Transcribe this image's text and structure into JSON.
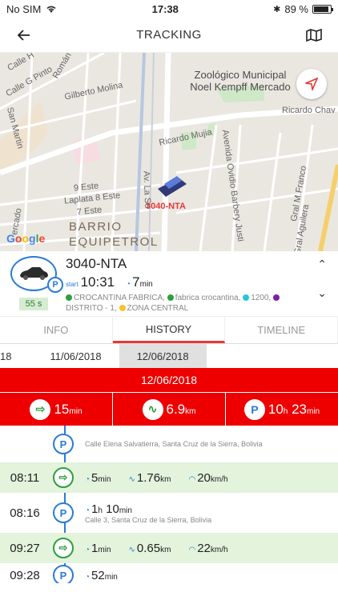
{
  "status": {
    "carrier": "No SIM",
    "time": "17:38",
    "battery": "89 %",
    "battery_level": 0.89
  },
  "nav": {
    "title": "TRACKING",
    "back_icon": "arrow-left-icon",
    "map_icon": "map-icon"
  },
  "map": {
    "labels": {
      "calle_h": "Calle H",
      "calle_g": "Calle G Pinto",
      "roman": "Román",
      "gilberto": "Gilberto Molina",
      "san_martin": "San Martin",
      "ricardo_chavez": "Ricardo Chav",
      "ricardo_mujia": "Ricardo Mujia",
      "este9": "9 Este",
      "laplata": "Laplata 8 Este",
      "este7": "7 Este",
      "av_la_se": "Av. La Se",
      "ovidio": "Avenida Ovidio Barbery Justi",
      "franco": "Gral M.Franco",
      "aguilera": "Gral Aguilera",
      "mercado": "ercado"
    },
    "poi": "Zoológico Municipal Noel Kempff Mercado",
    "district": "BARRIO EQUIPETROL",
    "car_label": "3040-NTA",
    "google": "Google"
  },
  "vehicle": {
    "plate": "3040-NTA",
    "start_label": "start",
    "start_time": "10:31",
    "duration": "7",
    "duration_unit": "min",
    "seconds": "55 s",
    "geofences": [
      {
        "name": "CROCANTINA FABRICA,",
        "color": "#2e9e3e"
      },
      {
        "name": "fabrica crocantina,",
        "color": "#2e9e3e"
      },
      {
        "name": "1200,",
        "color": "#26c6da"
      },
      {
        "name": "DISTRITO - 1,",
        "color": "#7b1fa2"
      },
      {
        "name": "ZONA CENTRAL",
        "color": "#fbc02d"
      }
    ]
  },
  "tabs": [
    "INFO",
    "HISTORY",
    "TIMELINE"
  ],
  "dates": [
    "18",
    "11/06/2018",
    "12/06/2018"
  ],
  "selected_date": "12/06/2018",
  "summary": {
    "moving": {
      "value": "15",
      "unit": "min"
    },
    "distance": {
      "value": "6.9",
      "unit": "km"
    },
    "parked": {
      "hours": "10",
      "h": "h",
      "minutes": "23",
      "unit": "min"
    }
  },
  "timeline": {
    "first_address": "Calle Elena Salvatierra, Santa Cruz de la Sierra, Bolivia",
    "rows": [
      {
        "time": "08:11",
        "type": "moving",
        "dur": "5",
        "dur_unit": "min",
        "dist": "1.76",
        "dist_unit": "km",
        "speed": "20",
        "speed_unit": "km/h"
      },
      {
        "time": "08:16",
        "type": "parked",
        "hours": "1",
        "h": "h",
        "mins": "10",
        "mins_unit": "min",
        "address": "Calle 3, Santa Cruz de la Sierra, Bolivia"
      },
      {
        "time": "09:27",
        "type": "moving",
        "dur": "1",
        "dur_unit": "min",
        "dist": "0.65",
        "dist_unit": "km",
        "speed": "22",
        "speed_unit": "km/h"
      },
      {
        "time": "09:28",
        "type": "parked",
        "dur": "52",
        "dur_unit": "min"
      }
    ]
  }
}
